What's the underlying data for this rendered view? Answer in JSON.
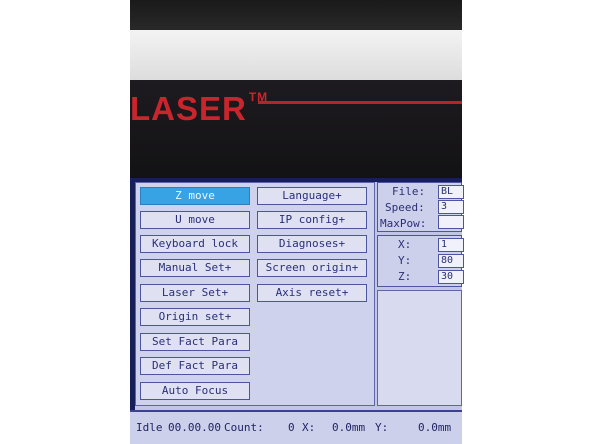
{
  "brand": {
    "text": "LASER",
    "tm": "TM"
  },
  "menu": {
    "left_column": [
      "Z move",
      "U move",
      "Keyboard lock",
      "Manual Set+",
      "Laser Set+",
      "Origin set+",
      "Set Fact Para",
      "Def Fact Para",
      "Auto Focus"
    ],
    "right_column": [
      "Language+",
      "IP config+",
      "Diagnoses+",
      "Screen origin+",
      "Axis reset+"
    ],
    "selected": "Z move"
  },
  "info": {
    "file_label": "File:",
    "file_value": "BL",
    "speed_label": "Speed:",
    "speed_value": "3",
    "maxpow_label": "MaxPow:",
    "maxpow_value": ""
  },
  "axes": {
    "x_label": "X:",
    "x_value": "1",
    "y_label": "Y:",
    "y_value": "80",
    "z_label": "Z:",
    "z_value": "30"
  },
  "status": {
    "state": "Idle",
    "time": "00.00.00",
    "count_label": "Count:",
    "count_value": "0",
    "x_label": "X:",
    "x_value": "0.0mm",
    "y_label": "Y:",
    "y_value": "0.0mm"
  }
}
